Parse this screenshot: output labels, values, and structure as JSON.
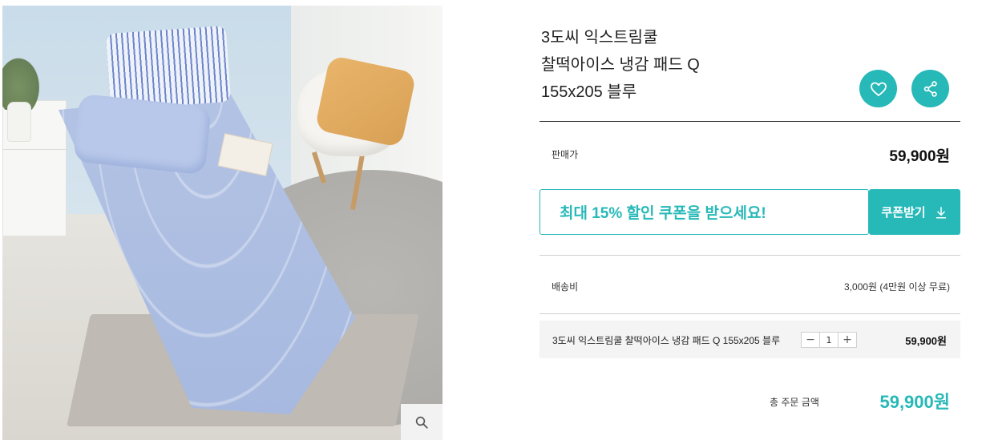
{
  "product": {
    "title_lines": [
      "3도씨 익스트림쿨",
      "찰떡아이스 냉감 패드 Q",
      "155x205 블루"
    ]
  },
  "actions": {
    "like_icon": "heart-icon",
    "share_icon": "share-icon"
  },
  "price": {
    "label": "판매가",
    "value": "59,900원"
  },
  "coupon": {
    "message": "최대 15% 할인 쿠폰을 받으세요!",
    "button_label": "쿠폰받기",
    "button_icon": "download-icon"
  },
  "shipping": {
    "label": "배송비",
    "value": "3,000원 (4만원 이상 무료)"
  },
  "selected_option": {
    "name": "3도씨 익스트림쿨 찰떡아이스 냉감 패드 Q 155x205 블루",
    "minus": "−",
    "quantity": "1",
    "plus": "+",
    "price": "59,900원"
  },
  "total": {
    "label": "총 주문 금액",
    "value": "59,900원"
  },
  "image": {
    "zoom_icon": "search-icon"
  },
  "colors": {
    "accent": "#27b8b8"
  }
}
